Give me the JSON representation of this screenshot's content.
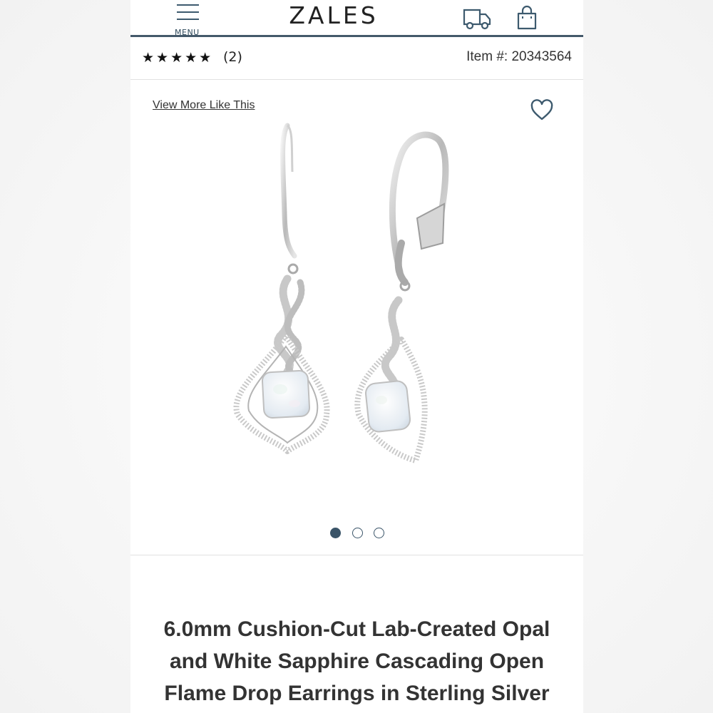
{
  "header": {
    "menu_label": "MENU",
    "logo_text": "ZALES",
    "accent_color": "#3d5a6e",
    "icons": [
      "menu-icon",
      "truck-icon",
      "bag-icon"
    ]
  },
  "rating": {
    "stars_text": "★★★★★",
    "stars_value": 5,
    "review_count": "(2)",
    "item_number": "Item #: 20343564"
  },
  "gallery": {
    "view_more_label": "View More Like This",
    "favorite_icon": "heart-icon",
    "image_count": 3,
    "active_image": 1
  },
  "product": {
    "title": "6.0mm Cushion-Cut Lab-Created Opal and White Sapphire Cascading Open Flame Drop Earrings in Sterling Silver"
  }
}
